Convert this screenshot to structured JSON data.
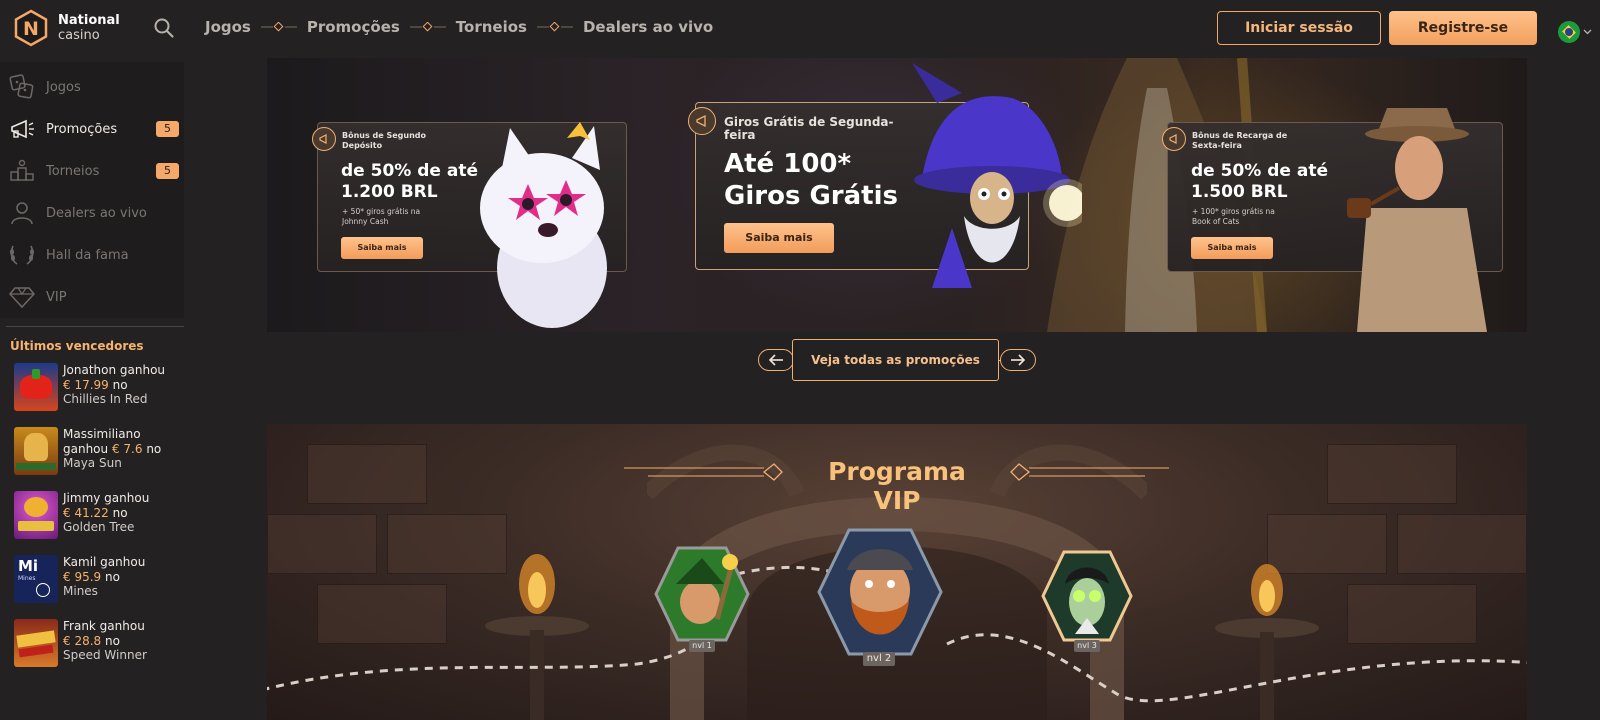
{
  "header": {
    "logo_line1": "National",
    "logo_line2": "casino",
    "logo_letter": "N",
    "nav": [
      "Jogos",
      "Promoções",
      "Torneios",
      "Dealers ao vivo"
    ],
    "login_label": "Iniciar sessão",
    "register_label": "Registre-se",
    "accent_color": "#f3a865"
  },
  "sidebar": {
    "items": [
      {
        "label": "Jogos",
        "icon": "games-icon"
      },
      {
        "label": "Promoções",
        "icon": "megaphone-icon",
        "badge": "5"
      },
      {
        "label": "Torneios",
        "icon": "tournament-icon",
        "badge": "5"
      },
      {
        "label": "Dealers ao vivo",
        "icon": "dealer-icon"
      },
      {
        "label": "Hall da fama",
        "icon": "laurel-icon"
      },
      {
        "label": "VIP",
        "icon": "diamond-icon"
      }
    ],
    "winners_title": "Últimos vencedores",
    "winners": [
      {
        "name_line": "Jonathon ganhou",
        "amount": "€ 17.99",
        "suffix": " no",
        "game": "Chillies In Red"
      },
      {
        "name_line": "Massimiliano",
        "name_line2": "ganhou ",
        "amount": "€ 7.6",
        "suffix": " no",
        "game": "Maya Sun"
      },
      {
        "name_line": "Jimmy ganhou",
        "amount": "€ 41.22",
        "suffix": " no",
        "game": "Golden Tree"
      },
      {
        "name_line": "Kamil ganhou",
        "amount": "€ 95.9",
        "suffix": " no",
        "game": "Mines",
        "thumb_text": "Mi",
        "thumb_sub": "Mines"
      },
      {
        "name_line": "Frank ganhou",
        "amount": "€ 28.8",
        "suffix": " no",
        "game": "Speed Winner"
      }
    ]
  },
  "promos": {
    "left": {
      "caption": "Bônus de Segundo Depósito",
      "headline1": "de 50% de até",
      "headline2": "1.200 BRL",
      "sub1": "+ 50* giros grátis na",
      "sub2": "Johnny Cash",
      "button": "Saiba mais"
    },
    "center": {
      "caption1": "Giros Grátis de Segunda-",
      "caption2": "feira",
      "headline1": "Até 100*",
      "headline2": "Giros Grátis",
      "button": "Saiba mais"
    },
    "right": {
      "caption1": "Bônus de Recarga de",
      "caption2": "Sexta-feira",
      "headline1": "de 50% de até",
      "headline2": "1.500 BRL",
      "sub1": "+ 100* giros grátis na",
      "sub2": "Book of Cats",
      "button": "Saiba mais"
    },
    "all_label": "Veja todas as promoções"
  },
  "vip": {
    "title": "Programa VIP",
    "levels": [
      "nvl 1",
      "nvl 2",
      "nvl 3"
    ]
  }
}
